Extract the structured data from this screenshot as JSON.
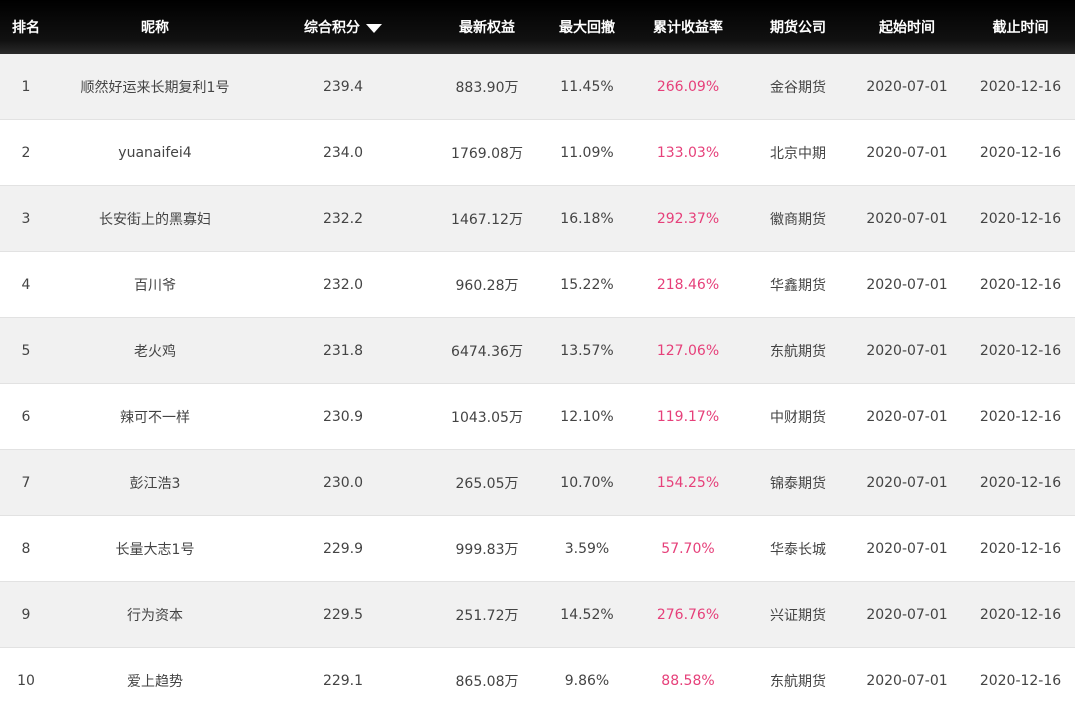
{
  "headers": {
    "rank": "排名",
    "name": "昵称",
    "score": "综合积分",
    "equity": "最新权益",
    "drawdown": "最大回撤",
    "return": "累计收益率",
    "company": "期货公司",
    "start": "起始时间",
    "end": "截止时间"
  },
  "sort_icon": "caret-down-icon",
  "colors": {
    "return_text": "#e6407a",
    "header_bg": "#000000",
    "row_alt_bg": "#f1f1f1"
  },
  "rows": [
    {
      "rank": "1",
      "name": "顺然好运来长期复利1号",
      "score": "239.4",
      "equity": "883.90万",
      "drawdown": "11.45%",
      "return": "266.09%",
      "company": "金谷期货",
      "start": "2020-07-01",
      "end": "2020-12-16"
    },
    {
      "rank": "2",
      "name": "yuanaifei4",
      "score": "234.0",
      "equity": "1769.08万",
      "drawdown": "11.09%",
      "return": "133.03%",
      "company": "北京中期",
      "start": "2020-07-01",
      "end": "2020-12-16"
    },
    {
      "rank": "3",
      "name": "长安街上的黑寡妇",
      "score": "232.2",
      "equity": "1467.12万",
      "drawdown": "16.18%",
      "return": "292.37%",
      "company": "徽商期货",
      "start": "2020-07-01",
      "end": "2020-12-16"
    },
    {
      "rank": "4",
      "name": "百川爷",
      "score": "232.0",
      "equity": "960.28万",
      "drawdown": "15.22%",
      "return": "218.46%",
      "company": "华鑫期货",
      "start": "2020-07-01",
      "end": "2020-12-16"
    },
    {
      "rank": "5",
      "name": "老火鸡",
      "score": "231.8",
      "equity": "6474.36万",
      "drawdown": "13.57%",
      "return": "127.06%",
      "company": "东航期货",
      "start": "2020-07-01",
      "end": "2020-12-16"
    },
    {
      "rank": "6",
      "name": "辣可不一样",
      "score": "230.9",
      "equity": "1043.05万",
      "drawdown": "12.10%",
      "return": "119.17%",
      "company": "中财期货",
      "start": "2020-07-01",
      "end": "2020-12-16"
    },
    {
      "rank": "7",
      "name": "彭江浩3",
      "score": "230.0",
      "equity": "265.05万",
      "drawdown": "10.70%",
      "return": "154.25%",
      "company": "锦泰期货",
      "start": "2020-07-01",
      "end": "2020-12-16"
    },
    {
      "rank": "8",
      "name": "长量大志1号",
      "score": "229.9",
      "equity": "999.83万",
      "drawdown": "3.59%",
      "return": "57.70%",
      "company": "华泰长城",
      "start": "2020-07-01",
      "end": "2020-12-16"
    },
    {
      "rank": "9",
      "name": "行为资本",
      "score": "229.5",
      "equity": "251.72万",
      "drawdown": "14.52%",
      "return": "276.76%",
      "company": "兴证期货",
      "start": "2020-07-01",
      "end": "2020-12-16"
    },
    {
      "rank": "10",
      "name": "爱上趋势",
      "score": "229.1",
      "equity": "865.08万",
      "drawdown": "9.86%",
      "return": "88.58%",
      "company": "东航期货",
      "start": "2020-07-01",
      "end": "2020-12-16"
    }
  ]
}
